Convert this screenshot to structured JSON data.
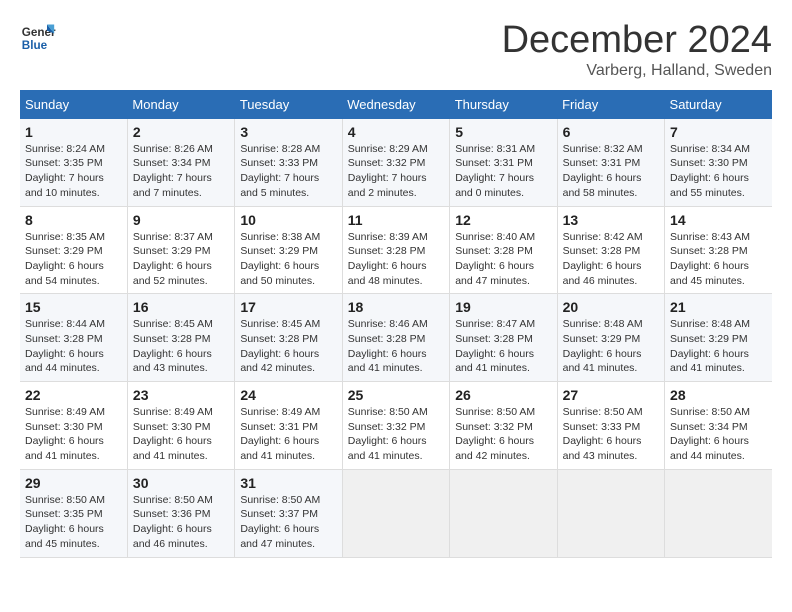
{
  "logo": {
    "general": "General",
    "blue": "Blue"
  },
  "title": "December 2024",
  "subtitle": "Varberg, Halland, Sweden",
  "headers": [
    "Sunday",
    "Monday",
    "Tuesday",
    "Wednesday",
    "Thursday",
    "Friday",
    "Saturday"
  ],
  "weeks": [
    [
      {
        "day": "1",
        "info": "Sunrise: 8:24 AM\nSunset: 3:35 PM\nDaylight: 7 hours\nand 10 minutes."
      },
      {
        "day": "2",
        "info": "Sunrise: 8:26 AM\nSunset: 3:34 PM\nDaylight: 7 hours\nand 7 minutes."
      },
      {
        "day": "3",
        "info": "Sunrise: 8:28 AM\nSunset: 3:33 PM\nDaylight: 7 hours\nand 5 minutes."
      },
      {
        "day": "4",
        "info": "Sunrise: 8:29 AM\nSunset: 3:32 PM\nDaylight: 7 hours\nand 2 minutes."
      },
      {
        "day": "5",
        "info": "Sunrise: 8:31 AM\nSunset: 3:31 PM\nDaylight: 7 hours\nand 0 minutes."
      },
      {
        "day": "6",
        "info": "Sunrise: 8:32 AM\nSunset: 3:31 PM\nDaylight: 6 hours\nand 58 minutes."
      },
      {
        "day": "7",
        "info": "Sunrise: 8:34 AM\nSunset: 3:30 PM\nDaylight: 6 hours\nand 55 minutes."
      }
    ],
    [
      {
        "day": "8",
        "info": "Sunrise: 8:35 AM\nSunset: 3:29 PM\nDaylight: 6 hours\nand 54 minutes."
      },
      {
        "day": "9",
        "info": "Sunrise: 8:37 AM\nSunset: 3:29 PM\nDaylight: 6 hours\nand 52 minutes."
      },
      {
        "day": "10",
        "info": "Sunrise: 8:38 AM\nSunset: 3:29 PM\nDaylight: 6 hours\nand 50 minutes."
      },
      {
        "day": "11",
        "info": "Sunrise: 8:39 AM\nSunset: 3:28 PM\nDaylight: 6 hours\nand 48 minutes."
      },
      {
        "day": "12",
        "info": "Sunrise: 8:40 AM\nSunset: 3:28 PM\nDaylight: 6 hours\nand 47 minutes."
      },
      {
        "day": "13",
        "info": "Sunrise: 8:42 AM\nSunset: 3:28 PM\nDaylight: 6 hours\nand 46 minutes."
      },
      {
        "day": "14",
        "info": "Sunrise: 8:43 AM\nSunset: 3:28 PM\nDaylight: 6 hours\nand 45 minutes."
      }
    ],
    [
      {
        "day": "15",
        "info": "Sunrise: 8:44 AM\nSunset: 3:28 PM\nDaylight: 6 hours\nand 44 minutes."
      },
      {
        "day": "16",
        "info": "Sunrise: 8:45 AM\nSunset: 3:28 PM\nDaylight: 6 hours\nand 43 minutes."
      },
      {
        "day": "17",
        "info": "Sunrise: 8:45 AM\nSunset: 3:28 PM\nDaylight: 6 hours\nand 42 minutes."
      },
      {
        "day": "18",
        "info": "Sunrise: 8:46 AM\nSunset: 3:28 PM\nDaylight: 6 hours\nand 41 minutes."
      },
      {
        "day": "19",
        "info": "Sunrise: 8:47 AM\nSunset: 3:28 PM\nDaylight: 6 hours\nand 41 minutes."
      },
      {
        "day": "20",
        "info": "Sunrise: 8:48 AM\nSunset: 3:29 PM\nDaylight: 6 hours\nand 41 minutes."
      },
      {
        "day": "21",
        "info": "Sunrise: 8:48 AM\nSunset: 3:29 PM\nDaylight: 6 hours\nand 41 minutes."
      }
    ],
    [
      {
        "day": "22",
        "info": "Sunrise: 8:49 AM\nSunset: 3:30 PM\nDaylight: 6 hours\nand 41 minutes."
      },
      {
        "day": "23",
        "info": "Sunrise: 8:49 AM\nSunset: 3:30 PM\nDaylight: 6 hours\nand 41 minutes."
      },
      {
        "day": "24",
        "info": "Sunrise: 8:49 AM\nSunset: 3:31 PM\nDaylight: 6 hours\nand 41 minutes."
      },
      {
        "day": "25",
        "info": "Sunrise: 8:50 AM\nSunset: 3:32 PM\nDaylight: 6 hours\nand 41 minutes."
      },
      {
        "day": "26",
        "info": "Sunrise: 8:50 AM\nSunset: 3:32 PM\nDaylight: 6 hours\nand 42 minutes."
      },
      {
        "day": "27",
        "info": "Sunrise: 8:50 AM\nSunset: 3:33 PM\nDaylight: 6 hours\nand 43 minutes."
      },
      {
        "day": "28",
        "info": "Sunrise: 8:50 AM\nSunset: 3:34 PM\nDaylight: 6 hours\nand 44 minutes."
      }
    ],
    [
      {
        "day": "29",
        "info": "Sunrise: 8:50 AM\nSunset: 3:35 PM\nDaylight: 6 hours\nand 45 minutes."
      },
      {
        "day": "30",
        "info": "Sunrise: 8:50 AM\nSunset: 3:36 PM\nDaylight: 6 hours\nand 46 minutes."
      },
      {
        "day": "31",
        "info": "Sunrise: 8:50 AM\nSunset: 3:37 PM\nDaylight: 6 hours\nand 47 minutes."
      },
      {
        "day": "",
        "info": ""
      },
      {
        "day": "",
        "info": ""
      },
      {
        "day": "",
        "info": ""
      },
      {
        "day": "",
        "info": ""
      }
    ]
  ]
}
